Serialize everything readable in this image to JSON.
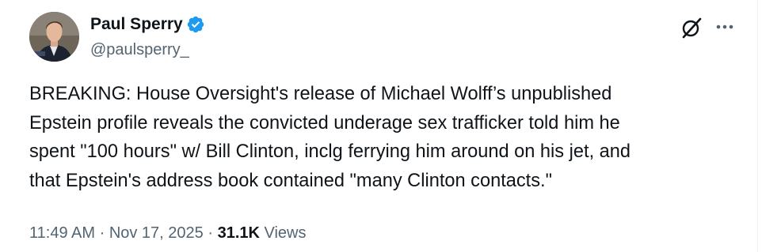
{
  "author": {
    "display_name": "Paul Sperry",
    "handle": "@paulsperry_",
    "verified": true,
    "avatar_icon": "avatar-photo"
  },
  "actions": {
    "grok_icon": "grok-icon",
    "more_icon": "more-icon"
  },
  "tweet": {
    "text": "BREAKING: House Oversight's release of Michael Wolff’s unpublished\nEpstein profile reveals the convicted underage sex trafficker told him he\nspent \"100 hours\" w/ Bill Clinton, inclg ferrying him around on his jet, and\nthat Epstein's address book contained \"many Clinton contacts.\""
  },
  "meta": {
    "time": "11:49 AM",
    "separator": " · ",
    "date": "Nov 17, 2025",
    "views_count": "31.1K",
    "views_label": " Views"
  },
  "colors": {
    "verified_badge": "#1d9bf0",
    "secondary_text": "#536471",
    "primary_text": "#0f1419"
  }
}
